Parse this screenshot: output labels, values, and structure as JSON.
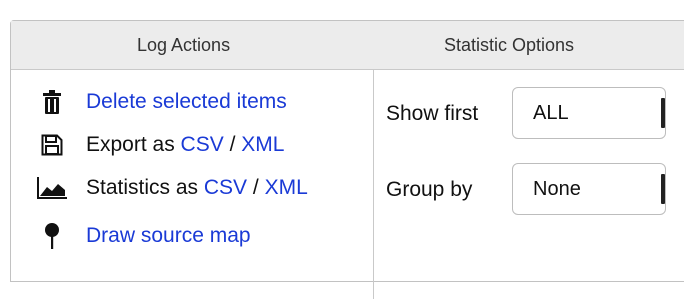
{
  "tabs": {
    "log_actions": "Log Actions",
    "statistic_options": "Statistic Options"
  },
  "actions": {
    "delete": {
      "label": "Delete selected items",
      "icon": "trash-icon"
    },
    "export": {
      "prefix": "Export as ",
      "csv": "CSV",
      "sep": " / ",
      "xml": "XML",
      "icon": "save-icon"
    },
    "statistics": {
      "prefix": "Statistics as ",
      "csv": "CSV",
      "sep": " / ",
      "xml": "XML",
      "icon": "area-chart-icon"
    },
    "draw_map": {
      "label": "Draw source map",
      "icon": "map-pin-icon"
    }
  },
  "options": {
    "show_first": {
      "label": "Show first",
      "value": "ALL"
    },
    "group_by": {
      "label": "Group by",
      "value": "None"
    }
  },
  "colors": {
    "link": "#1a3ad6",
    "header_bg": "#ececec",
    "border": "#c2c2c2"
  }
}
